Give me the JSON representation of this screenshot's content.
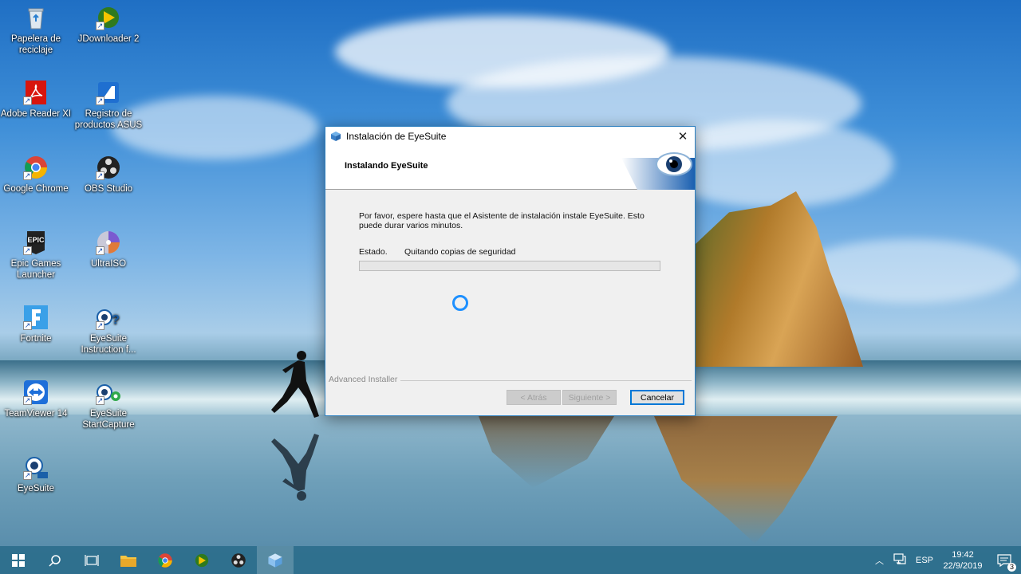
{
  "desktop": {
    "icons": [
      {
        "label": "Papelera de reciclaje",
        "icon": "recycle-bin-icon"
      },
      {
        "label": "JDownloader 2",
        "icon": "jdownloader-icon"
      },
      {
        "label": "Adobe Reader XI",
        "icon": "adobe-reader-icon"
      },
      {
        "label": "Registro de productos ASUS",
        "icon": "asus-registration-icon"
      },
      {
        "label": "Google Chrome",
        "icon": "chrome-icon"
      },
      {
        "label": "OBS Studio",
        "icon": "obs-icon"
      },
      {
        "label": "Epic Games Launcher",
        "icon": "epic-games-icon"
      },
      {
        "label": "UltraISO",
        "icon": "ultraiso-icon"
      },
      {
        "label": "Fortnite",
        "icon": "fortnite-icon"
      },
      {
        "label": "EyeSuite Instruction f...",
        "icon": "eyesuite-help-icon"
      },
      {
        "label": "TeamViewer 14",
        "icon": "teamviewer-icon"
      },
      {
        "label": "EyeSuite StartCapture",
        "icon": "eyesuite-capture-icon"
      },
      {
        "label": "EyeSuite",
        "icon": "eyesuite-icon"
      }
    ]
  },
  "dialog": {
    "title": "Instalación de EyeSuite",
    "header_title": "Instalando EyeSuite",
    "description": "Por favor, espere hasta que el Asistente de instalación instale EyeSuite.  Esto puede durar varios minutos.",
    "status_label": "Estado.",
    "status_value": "Quitando copias de seguridad",
    "progress": 0,
    "brand_label": "Advanced Installer",
    "buttons": {
      "back": "< Atrás",
      "next": "Siguiente >",
      "cancel": "Cancelar"
    }
  },
  "taskbar": {
    "items": [
      "start-icon",
      "search-icon",
      "task-view-icon",
      "file-explorer-icon",
      "chrome-icon",
      "jdownloader-icon",
      "obs-icon",
      "installer-icon"
    ],
    "language": "ESP",
    "time": "19:42",
    "date": "22/9/2019",
    "notification_count": "3"
  },
  "colors": {
    "accent": "#0078d7",
    "dialog_border": "#2b7fc0",
    "taskbar": "#2d6e8c"
  }
}
